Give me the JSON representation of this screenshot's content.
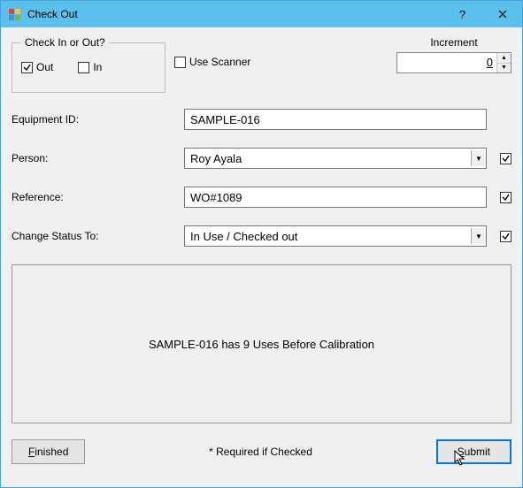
{
  "window": {
    "title": "Check Out"
  },
  "groupbox": {
    "legend": "Check In or Out?",
    "out_label": "Out",
    "in_label": "In",
    "out_checked": true,
    "in_checked": false
  },
  "use_scanner": {
    "label": "Use Scanner",
    "checked": false
  },
  "increment": {
    "label": "Increment",
    "value": "0"
  },
  "fields": {
    "equipment_id": {
      "label": "Equipment ID:",
      "value": "SAMPLE-016"
    },
    "person": {
      "label": "Person:",
      "value": "Roy Ayala",
      "trail_checked": true
    },
    "reference": {
      "label": "Reference:",
      "value": "WO#1089",
      "trail_checked": true
    },
    "change_status": {
      "label": "Change Status To:",
      "value": "In Use / Checked out",
      "trail_checked": true
    }
  },
  "status_message": "SAMPLE-016 has 9 Uses Before Calibration",
  "buttons": {
    "finished": "Finished",
    "submit": "Submit"
  },
  "required_note": "* Required if Checked"
}
